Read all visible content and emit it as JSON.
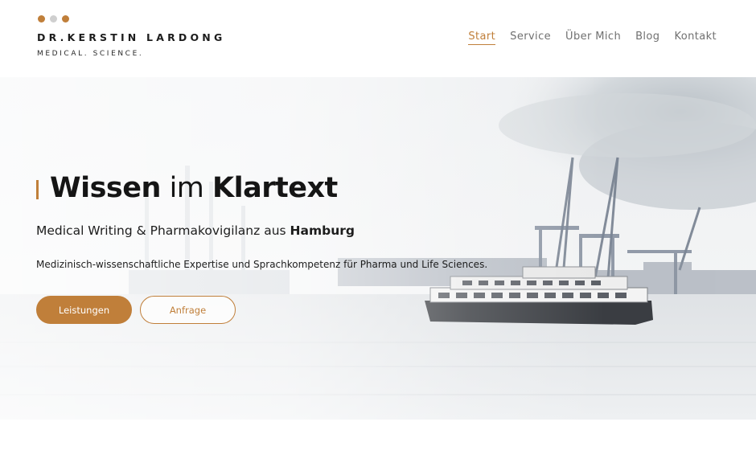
{
  "colors": {
    "accent": "#c07f3a",
    "dot_gray": "#cfcfcf",
    "text_dark": "#151515",
    "nav_text": "#707070"
  },
  "logo": {
    "name": "DR.KERSTIN LARDONG",
    "tagline": "MEDICAL. SCIENCE."
  },
  "nav": {
    "items": [
      {
        "label": "Start",
        "active": true
      },
      {
        "label": "Service",
        "active": false
      },
      {
        "label": "Über Mich",
        "active": false
      },
      {
        "label": "Blog",
        "active": false
      },
      {
        "label": "Kontakt",
        "active": false
      }
    ]
  },
  "hero": {
    "title": {
      "part1": "Wissen",
      "part2": " im ",
      "part3": "Klartext"
    },
    "subtitle": {
      "text": "Medical Writing & Pharmakovigilanz aus ",
      "bold": "Hamburg"
    },
    "description": "Medizinisch-wissenschaftliche Expertise und Sprachkompetenz für Pharma und Life Sciences.",
    "buttons": {
      "primary": "Leistungen",
      "secondary": "Anfrage"
    }
  }
}
